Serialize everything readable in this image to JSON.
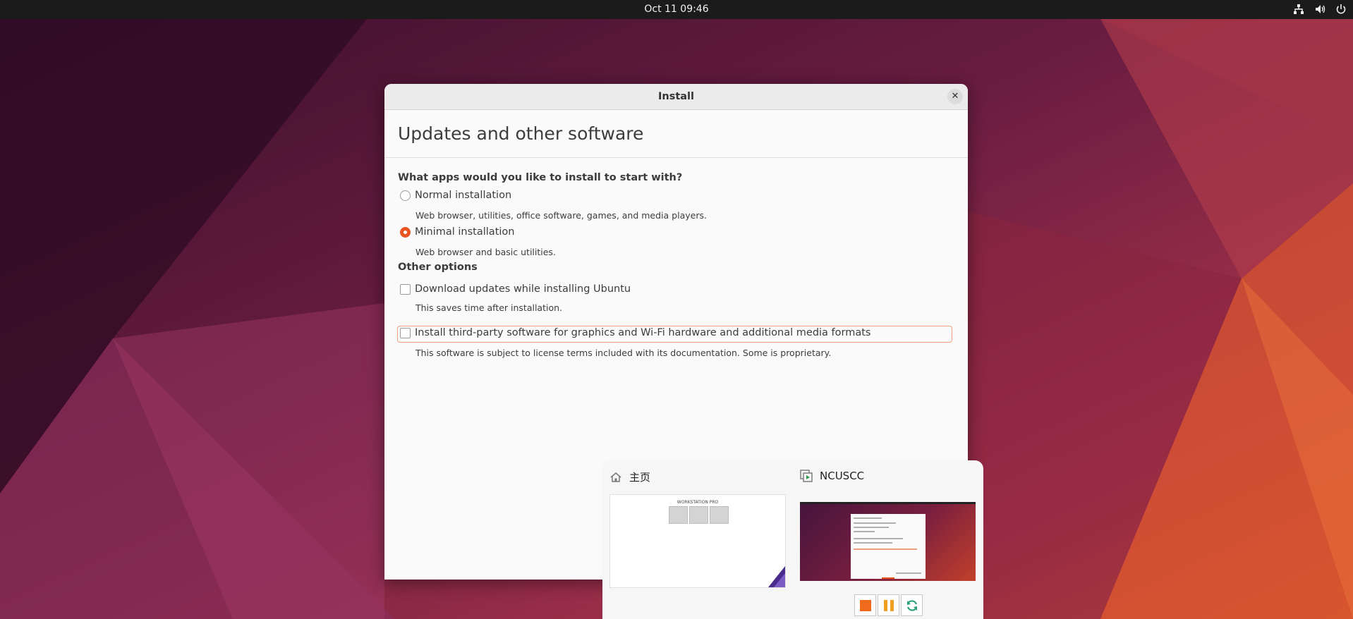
{
  "topbar": {
    "datetime": "Oct 11  09:46",
    "tray_icons": [
      "network-icon",
      "volume-icon",
      "power-icon"
    ]
  },
  "dialog": {
    "window_title": "Install",
    "heading": "Updates and other software",
    "question": "What apps would you like to install to start with?",
    "options": [
      {
        "label": "Normal installation",
        "description": "Web browser, utilities, office software, games, and media players.",
        "selected": false
      },
      {
        "label": "Minimal installation",
        "description": "Web browser and basic utilities.",
        "selected": true
      }
    ],
    "other_options_label": "Other options",
    "checks": [
      {
        "label": "Download updates while installing Ubuntu",
        "description": "This saves time after installation.",
        "checked": false
      },
      {
        "label": "Install third-party software for graphics and Wi-Fi hardware and additional media formats",
        "description": "This software is subject to license terms included with its documentation. Some is proprietary.",
        "checked": false
      }
    ]
  },
  "switcher": {
    "windows": [
      {
        "title": "主页",
        "icon": "home-icon",
        "thumbnail_text": "WORKSTATION PRO"
      },
      {
        "title": "NCUSCC",
        "icon": "vm-icon"
      }
    ],
    "controls": [
      "stop-icon",
      "pause-icon",
      "restart-icon"
    ]
  },
  "colors": {
    "accent": "#e95420",
    "topbar": "#1b1b1b",
    "dialog_bg": "#fafafa"
  }
}
